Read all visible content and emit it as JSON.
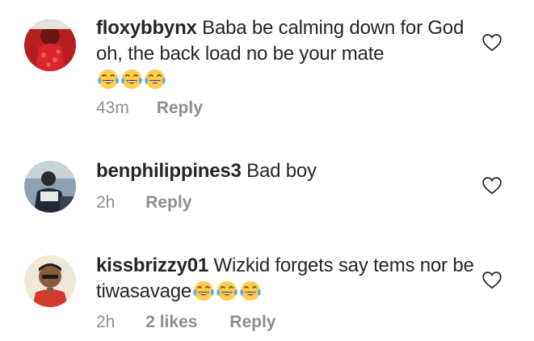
{
  "comments": [
    {
      "username": "floxybbynx",
      "text": "Baba be calming down for God oh, the back load no be your mate",
      "emoji": [
        "face-with-tears-of-joy",
        "face-with-tears-of-joy",
        "face-with-tears-of-joy"
      ],
      "time": "43m",
      "likes": "",
      "reply_label": "Reply"
    },
    {
      "username": "benphilippines3",
      "text": "Bad boy",
      "emoji": [],
      "time": "2h",
      "likes": "",
      "reply_label": "Reply"
    },
    {
      "username": "kissbrizzy01",
      "text": "Wizkid forgets say tems nor be tiwasavage",
      "emoji": [
        "face-with-tears-of-joy",
        "face-with-tears-of-joy",
        "face-with-tears-of-joy"
      ],
      "time": "2h",
      "likes": "2 likes",
      "reply_label": "Reply"
    }
  ],
  "icons": {
    "like": "heart-outline-icon"
  },
  "colors": {
    "text": "#262626",
    "muted": "#8e8e8e",
    "emoji": "#FFCC4D"
  }
}
